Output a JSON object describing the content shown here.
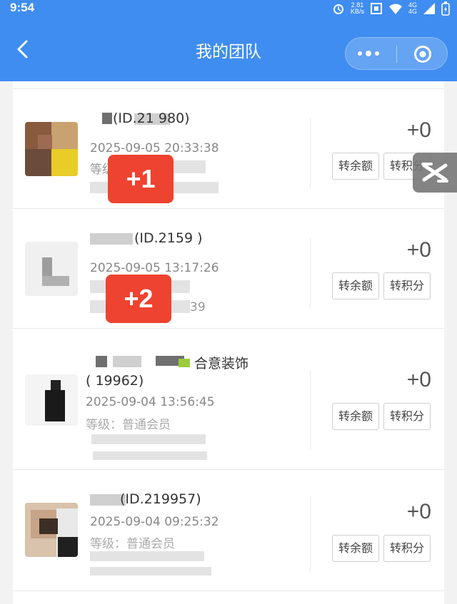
{
  "status_bar": {
    "time": "9:54",
    "speed_value": "2.81",
    "speed_unit": "KB/s",
    "network": "4G"
  },
  "header": {
    "title": "我的团队",
    "back_icon": "chevron-left-icon",
    "more_icon": "more-dots-icon",
    "close_icon": "target-icon"
  },
  "members": [
    {
      "name": "(ID.21 980)",
      "time": "2025-09-05 20:33:38",
      "level": "等级",
      "points": "+0",
      "btn_balance": "转余额",
      "btn_points": "转积分"
    },
    {
      "name": "(ID.2159 )",
      "time": "2025-09-05 13:17:26",
      "level": "",
      "tail": "39",
      "points": "+0",
      "btn_balance": "转余额",
      "btn_points": "转积分"
    },
    {
      "name": "合意装饰",
      "id_line": "( 19962)",
      "time": "2025-09-04 13:56:45",
      "level": "等级：普通会员",
      "points": "+0",
      "btn_balance": "转余额",
      "btn_points": "转积分"
    },
    {
      "name": "(ID.219957)",
      "time": "2025-09-04 09:25:32",
      "level": "等级：普通会员",
      "points": "+0",
      "btn_balance": "转余额",
      "btn_points": "转积分"
    }
  ],
  "badges": [
    "+1",
    "+2"
  ],
  "floating_icon": "capcut-icon"
}
